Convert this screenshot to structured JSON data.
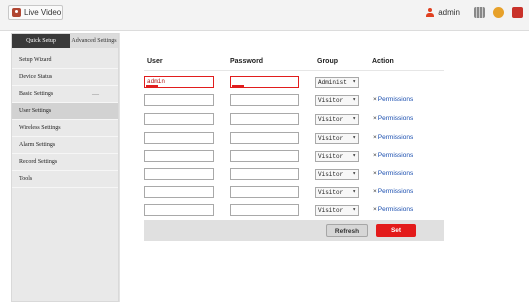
{
  "topbar": {
    "live_video": "Live Video",
    "username": "admin",
    "icons": [
      "user-icon",
      "grid-icon",
      "help-icon",
      "logout-icon"
    ]
  },
  "left": {
    "tabs": [
      "Quick Setup",
      "Advanced Settings"
    ],
    "menu": [
      {
        "label": "Setup Wizard"
      },
      {
        "label": "Device Status"
      },
      {
        "label": "Basic Settings",
        "extra": "—"
      },
      {
        "label": "User Settings"
      },
      {
        "label": "Wireless Settings"
      },
      {
        "label": "Alarm Settings"
      },
      {
        "label": "Record Settings"
      },
      {
        "label": "Tools"
      }
    ]
  },
  "main": {
    "headers": {
      "user": "User",
      "password": "Password",
      "group": "Group",
      "action": "Action"
    },
    "rows": [
      {
        "user": "admin",
        "password": "",
        "group": "Administ",
        "action": ""
      },
      {
        "user": "",
        "password": "",
        "group": "Visitor",
        "action": "Permissions"
      },
      {
        "user": "",
        "password": "",
        "group": "Visitor",
        "action": "Permissions"
      },
      {
        "user": "",
        "password": "",
        "group": "Visitor",
        "action": "Permissions"
      },
      {
        "user": "",
        "password": "",
        "group": "Visitor",
        "action": "Permissions"
      },
      {
        "user": "",
        "password": "",
        "group": "Visitor",
        "action": "Permissions"
      },
      {
        "user": "",
        "password": "",
        "group": "Visitor",
        "action": "Permissions"
      },
      {
        "user": "",
        "password": "",
        "group": "Visitor",
        "action": "Permissions"
      }
    ],
    "buttons": {
      "refresh": "Refresh",
      "set": "Set"
    }
  },
  "colors": {
    "accent": "#e31b1b",
    "link": "#1b4fb0"
  }
}
